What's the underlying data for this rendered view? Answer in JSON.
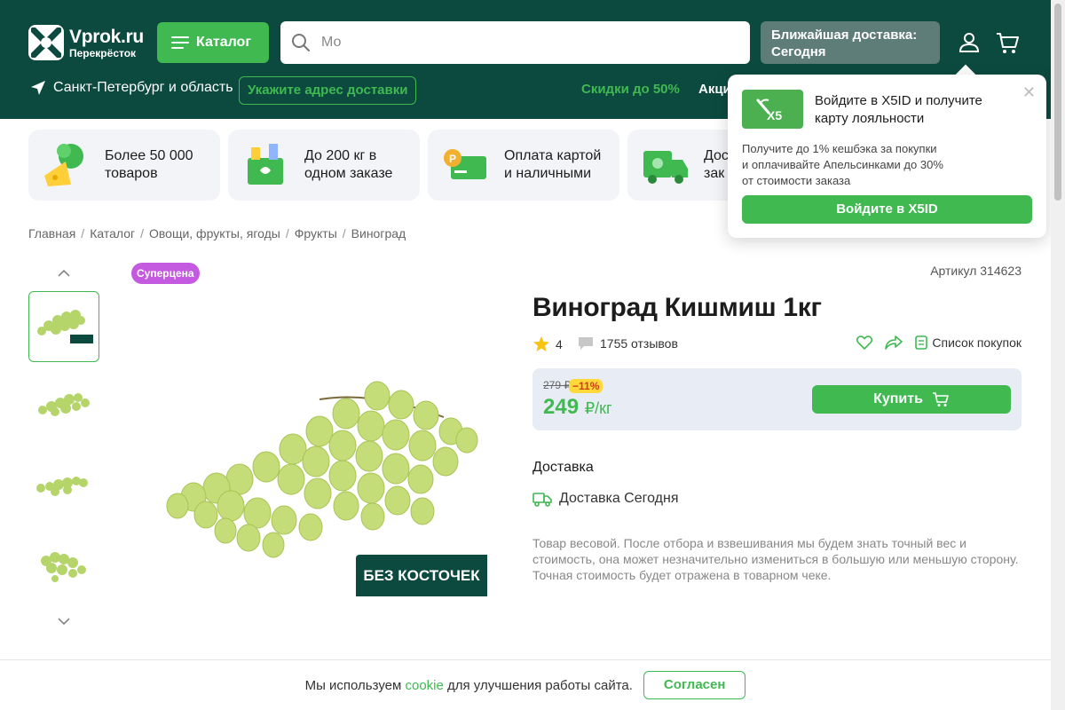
{
  "header": {
    "logo_name": "Vprok.ru",
    "logo_sub": "Перекрёсток",
    "catalog_label": "Каталог",
    "search_value": "Мо",
    "delivery_badge_l1": "Ближайшая доставка:",
    "delivery_badge_l2": "Сегодня",
    "city": "Санкт-Петербург и область",
    "address_btn": "Укажите адрес доставки",
    "promo": "Скидки до 50%",
    "promo2": "Акци",
    "brand_color": "#0c4a3f",
    "accent_color": "#3fb950"
  },
  "features": [
    {
      "l1": "Более 50 000",
      "l2": "товаров",
      "icon": "cheese-broccoli-icon"
    },
    {
      "l1": "До 200 кг в",
      "l2": "одном заказе",
      "icon": "grocery-box-icon"
    },
    {
      "l1": "Оплата картой",
      "l2": "и наличными",
      "icon": "card-coin-icon"
    },
    {
      "l1": "Дос",
      "l2": "зак",
      "icon": "delivery-truck-icon"
    }
  ],
  "breadcrumb": [
    "Главная",
    "Каталог",
    "Овощи, фрукты, ягоды",
    "Фрукты",
    "Виноград"
  ],
  "product": {
    "badge": "Суперцена",
    "article": "Артикул 314623",
    "title": "Виноград Кишмиш 1кг",
    "rating": "4",
    "reviews": "1755 отзывов",
    "shopping_list": "Список покупок",
    "old_price": "279 ₽",
    "discount": "−11%",
    "price": "249",
    "price_unit": "₽/кг",
    "buy_label": "Купить",
    "seedless_label": "БЕЗ КОСТОЧЕК",
    "delivery_heading": "Доставка",
    "delivery_text": "Доставка Сегодня",
    "note": "Товар весовой. После отбора и взвешивания мы будем знать точный вес и стоимость, она может незначительно измениться в большую или меньшую сторону. Точная стоимость будет отражена в товарном чеке."
  },
  "popup": {
    "logo": "X5",
    "title": "Войдите в X5ID и получите карту лояльности",
    "text_l1": "Получите до 1% кешбэка за покупки",
    "text_l2": "и оплачивайте Апельсинками до 30%",
    "text_l3": "от стоимости заказа",
    "button": "Войдите в X5ID"
  },
  "cookie": {
    "text_before": "Мы используем",
    "link": "cookie",
    "text_after": "для улучшения работы сайта.",
    "button": "Согласен"
  }
}
